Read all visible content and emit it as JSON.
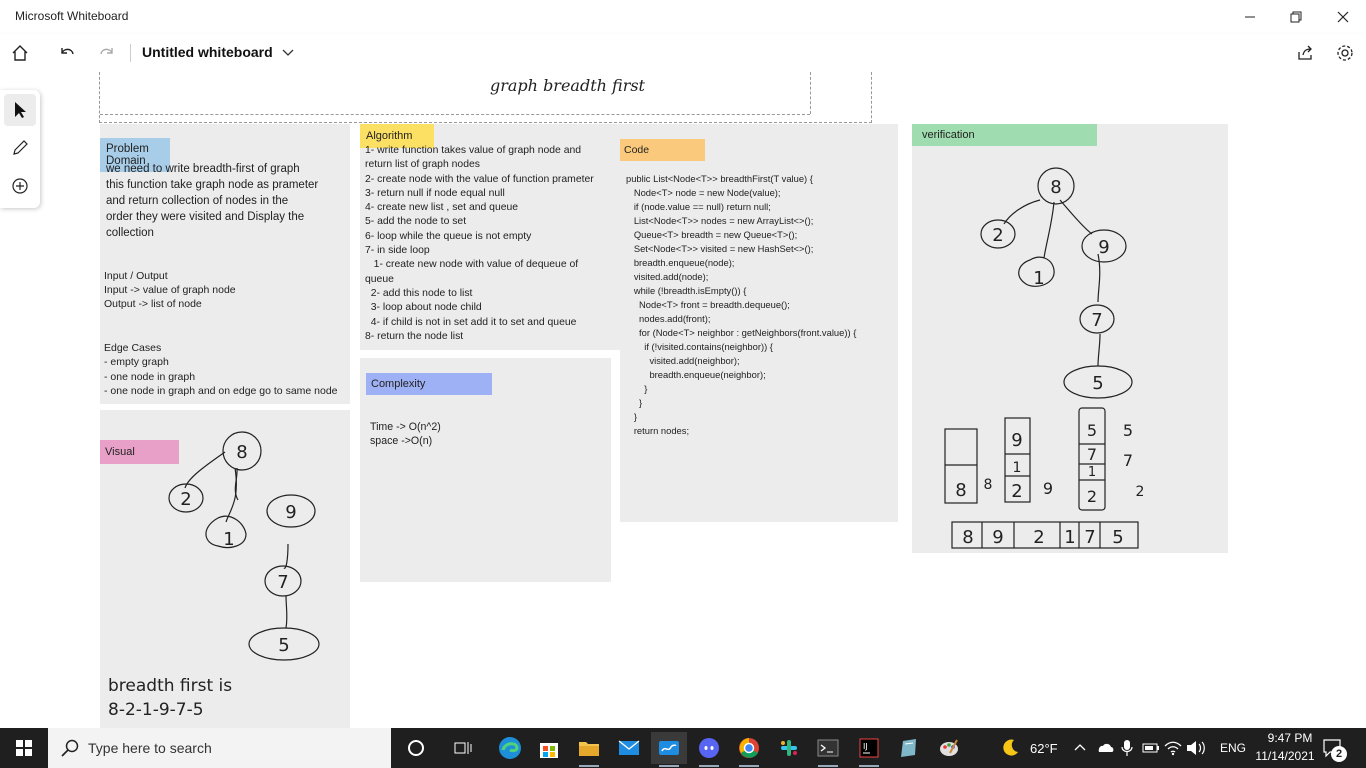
{
  "window": {
    "app_title": "Microsoft Whiteboard"
  },
  "appbar": {
    "board_title": "Untitled whiteboard"
  },
  "board": {
    "heading": "graph breadth first",
    "problem": {
      "tag": "Problem Domain",
      "description": [
        "we need to write breadth-first of graph",
        "this function take graph node as prameter",
        "and return collection of nodes in the",
        "order they were visited and Display the",
        "collection"
      ],
      "io": [
        "Input / Output",
        "Input -> value of graph node",
        "Output -> list of node"
      ],
      "edge": [
        "Edge Cases",
        "- empty graph",
        "- one node in graph",
        "- one node in graph and on edge go to same node"
      ]
    },
    "visual": {
      "tag": "Visual",
      "result_line1": "breadth first is",
      "result_line2": "8-2-1-9-7-5",
      "nodes": [
        "8",
        "2",
        "9",
        "1",
        "7",
        "5"
      ]
    },
    "algorithm": {
      "tag": "Algorithm",
      "lines": [
        "1- write function takes value of graph node and",
        "return list of graph nodes",
        "2- create node with the value of function prameter",
        "3- return null if node equal null",
        "4- create new list , set and queue",
        "5- add the node to set",
        "6- loop while the queue is not empty",
        "7- in side loop",
        "   1- create new node with value of dequeue of",
        "queue",
        "  2- add this node to list",
        "  3- loop about node child",
        "  4- if child is not in set add it to set and queue",
        "8- return the node list"
      ]
    },
    "complexity": {
      "tag": "Complexity",
      "time": "Time -> O(n^2)",
      "space": "space ->O(n)"
    },
    "code": {
      "tag": "Code",
      "lines": [
        "public List<Node<T>> breadthFirst(T value) {",
        "   Node<T> node = new Node(value);",
        "   if (node.value == null) return null;",
        "   List<Node<T>> nodes = new ArrayList<>();",
        "   Queue<T> breadth = new Queue<T>();",
        "   Set<Node<T>> visited = new HashSet<>();",
        "",
        "   breadth.enqueue(node);",
        "   visited.add(node);",
        "",
        "   while (!breadth.isEmpty()) {",
        "     Node<T> front = breadth.dequeue();",
        "     nodes.add(front);",
        "     for (Node<T> neighbor : getNeighbors(front.value)) {",
        "       if (!visited.contains(neighbor)) {",
        "         visited.add(neighbor);",
        "         breadth.enqueue(neighbor);",
        "       }",
        "     }",
        "   }",
        "   return nodes;"
      ]
    },
    "verification": {
      "tag": "verification",
      "nodes": [
        "8",
        "2",
        "9",
        "1",
        "7",
        "5"
      ],
      "queue_labels": [
        "8",
        "9",
        "2",
        "1",
        "7",
        "5"
      ],
      "result_cells": [
        "8",
        "9",
        "2",
        "1",
        "7",
        "5"
      ]
    }
  },
  "taskbar": {
    "search_placeholder": "Type here to search",
    "weather": "62°F",
    "language": "ENG",
    "time": "9:47 PM",
    "date": "11/14/2021",
    "notification_count": "2"
  }
}
